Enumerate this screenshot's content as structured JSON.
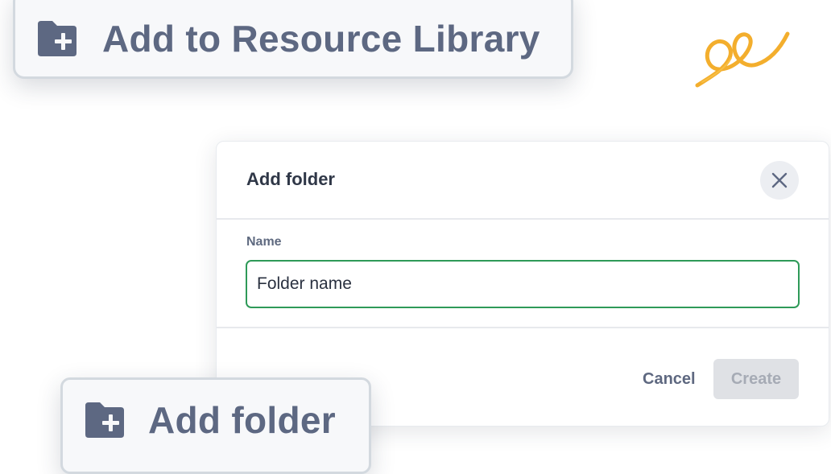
{
  "callouts": {
    "top_label": "Add to Resource Library",
    "bottom_label": "Add folder"
  },
  "modal": {
    "title": "Add folder",
    "name_label": "Name",
    "name_value": "Folder name",
    "cancel_label": "Cancel",
    "create_label": "Create"
  },
  "icons": {
    "callout_icon": "folder-plus-icon",
    "close_icon": "close-icon",
    "decoration": "squiggle-doodle"
  },
  "colors": {
    "callout_text": "#5d6882",
    "input_focus_border": "#2e9a58",
    "disabled_button_bg": "#dfe1e5",
    "squiggle": "#f2a516"
  }
}
